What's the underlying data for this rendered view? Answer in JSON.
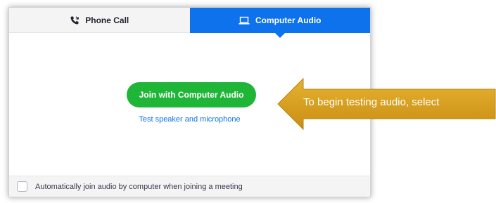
{
  "tabs": [
    {
      "label": "Phone Call",
      "icon": "phone-icon",
      "selected": false
    },
    {
      "label": "Computer Audio",
      "icon": "laptop-icon",
      "selected": true
    }
  ],
  "main": {
    "join_button_label": "Join with Computer Audio",
    "test_link_label": "Test speaker and microphone"
  },
  "footer": {
    "auto_join_label": "Automatically join audio by computer when joining a meeting",
    "auto_join_checked": false
  },
  "callout": {
    "text": "To begin testing audio, select"
  },
  "colors": {
    "accent_blue": "#0e72ed",
    "join_green": "#1fb537",
    "callout_gold": "#d9a21b"
  }
}
